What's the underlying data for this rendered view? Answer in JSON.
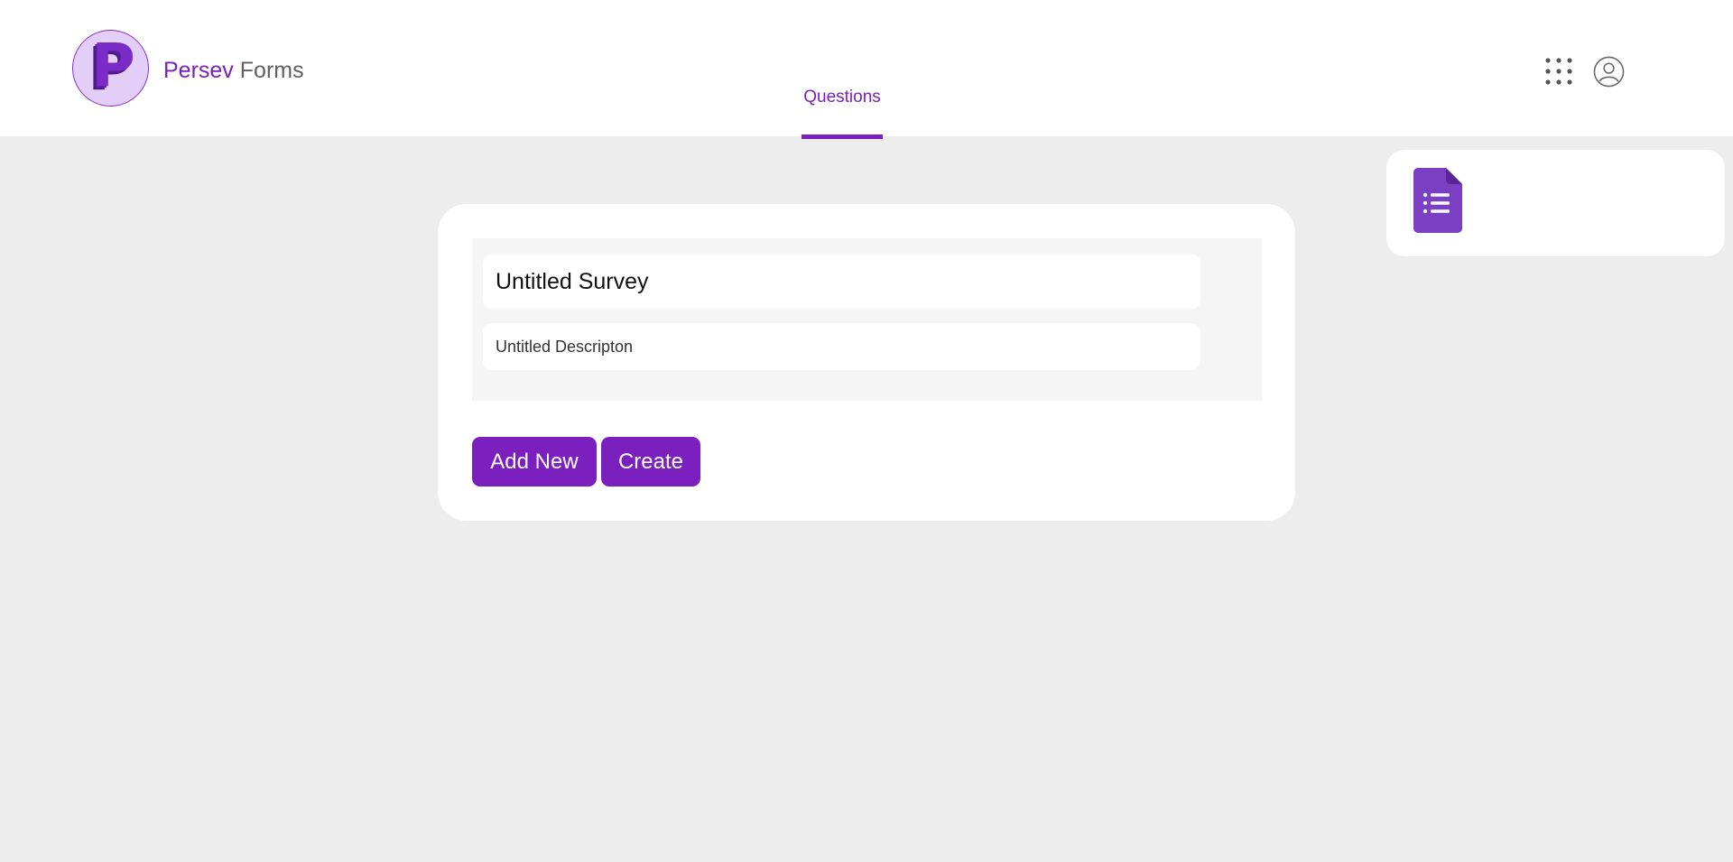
{
  "header": {
    "logo_letter": "P",
    "brand_primary": "Persev",
    "brand_secondary": "Forms",
    "tabs": [
      {
        "label": "Questions",
        "active": true
      }
    ],
    "icons": {
      "apps": "apps-grid-icon",
      "account": "account-circle-icon"
    }
  },
  "side_panel": {
    "icon": "forms-document-icon"
  },
  "form": {
    "title_value": "Untitled Survey",
    "description_value": "Untitled Descripton",
    "add_new_label": "Add New",
    "create_label": "Create"
  },
  "colors": {
    "accent": "#7b1fbf",
    "background": "#ededed",
    "card": "#ffffff",
    "title_block": "#f5f5f5",
    "logo_bg": "#e2cef7",
    "forms_icon": "#7b3fc4"
  }
}
